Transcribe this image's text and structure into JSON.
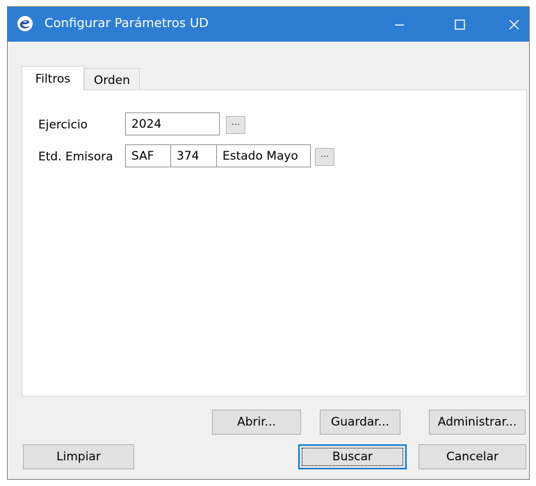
{
  "window": {
    "title": "Configurar Parámetros UD",
    "icons": {
      "app": "app-logo-icon",
      "minimize": "minimize-icon",
      "maximize": "maximize-icon",
      "close": "close-icon"
    },
    "titlebar_color": "#2d7dd2"
  },
  "tabs": [
    {
      "label": "Filtros",
      "active": true
    },
    {
      "label": "Orden",
      "active": false
    }
  ],
  "filters": {
    "ejercicio": {
      "label": "Ejercicio",
      "value": "2024",
      "browse_label": "..."
    },
    "emisora": {
      "label": "Etd. Emisora",
      "code": "SAF",
      "number": "374",
      "name": "Estado Mayo",
      "browse_label": "..."
    }
  },
  "buttons": {
    "abrir": "Abrir...",
    "guardar": "Guardar...",
    "administrar": "Administrar...",
    "limpiar": "Limpiar",
    "buscar": "Buscar",
    "cancelar": "Cancelar"
  }
}
